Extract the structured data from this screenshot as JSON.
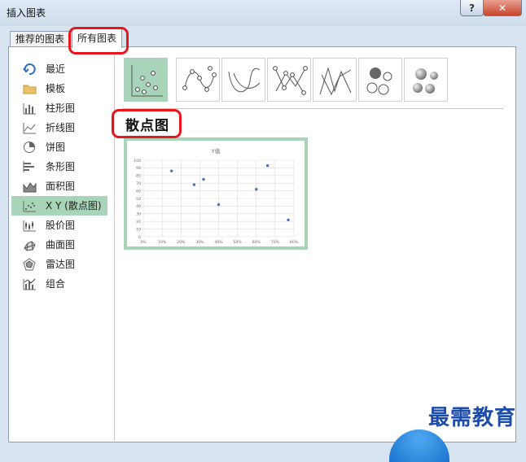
{
  "window": {
    "title": "插入图表",
    "help_label": "?",
    "close_label": "✕"
  },
  "tabs": [
    {
      "label": "推荐的图表"
    },
    {
      "label": "所有图表"
    }
  ],
  "sidebar": {
    "items": [
      {
        "label": "最近",
        "icon": "recent-icon"
      },
      {
        "label": "模板",
        "icon": "folder-icon"
      },
      {
        "label": "柱形图",
        "icon": "column-chart-icon"
      },
      {
        "label": "折线图",
        "icon": "line-chart-icon"
      },
      {
        "label": "饼图",
        "icon": "pie-chart-icon"
      },
      {
        "label": "条形图",
        "icon": "bar-chart-icon"
      },
      {
        "label": "面积图",
        "icon": "area-chart-icon"
      },
      {
        "label": "X Y (散点图)",
        "icon": "scatter-chart-icon"
      },
      {
        "label": "股价图",
        "icon": "stock-chart-icon"
      },
      {
        "label": "曲面图",
        "icon": "surface-chart-icon"
      },
      {
        "label": "雷达图",
        "icon": "radar-chart-icon"
      },
      {
        "label": "组合",
        "icon": "combo-chart-icon"
      }
    ],
    "selected_index": 7
  },
  "subtypes": [
    {
      "icon": "scatter-icon"
    },
    {
      "icon": "scatter-smooth-lines-markers-icon"
    },
    {
      "icon": "scatter-smooth-lines-icon"
    },
    {
      "icon": "scatter-straight-lines-markers-icon"
    },
    {
      "icon": "scatter-straight-lines-icon"
    },
    {
      "icon": "bubble-icon"
    },
    {
      "icon": "3d-bubble-icon"
    }
  ],
  "section_title": "散点图",
  "chart_data": {
    "type": "scatter",
    "title": "Y值",
    "xlim": [
      0,
      0.8
    ],
    "ylim": [
      0,
      100
    ],
    "x_ticks": [
      "0%",
      "10%",
      "20%",
      "30%",
      "40%",
      "50%",
      "60%",
      "70%",
      "80%"
    ],
    "y_ticks": [
      "0",
      "10",
      "20",
      "30",
      "40",
      "50",
      "60",
      "70",
      "80",
      "90",
      "100"
    ],
    "grid": true,
    "points": [
      {
        "x": 0.15,
        "y": 86
      },
      {
        "x": 0.27,
        "y": 68
      },
      {
        "x": 0.32,
        "y": 75
      },
      {
        "x": 0.4,
        "y": 42
      },
      {
        "x": 0.6,
        "y": 62
      },
      {
        "x": 0.66,
        "y": 93
      },
      {
        "x": 0.77,
        "y": 22
      }
    ],
    "color": "#4472c4"
  },
  "colors": {
    "accent_green": "#a8d5b9",
    "highlight_red": "#e8151b",
    "point_blue": "#4472c4"
  },
  "watermark": "最需教育"
}
